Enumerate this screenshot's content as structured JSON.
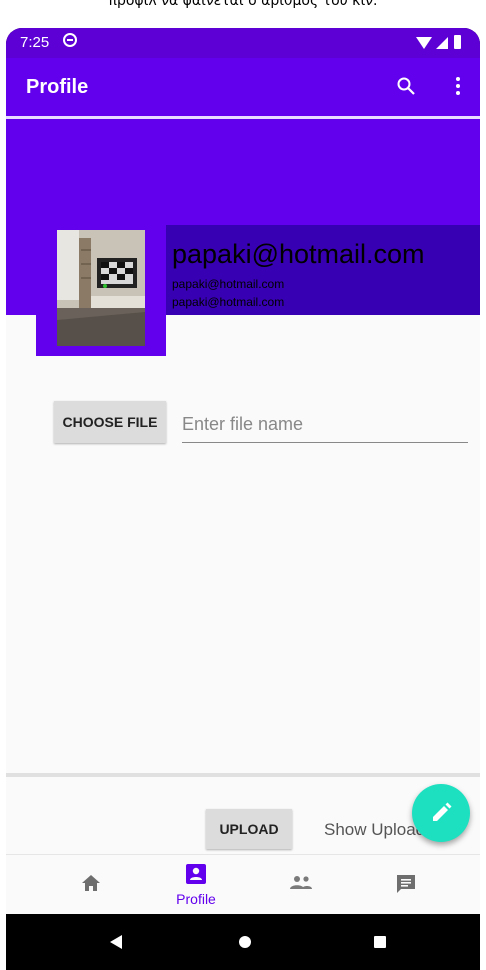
{
  "caption": "προφίλ να φαίνεται ο αριθμός του κιν.",
  "status": {
    "time": "7:25"
  },
  "appbar": {
    "title": "Profile"
  },
  "profile": {
    "email_main": "papaki@hotmail.com",
    "email_sub1": "papaki@hotmail.com",
    "email_sub2": "papaki@hotmail.com"
  },
  "file": {
    "choose_label": "CHOOSE FILE",
    "placeholder": "Enter file name",
    "value": ""
  },
  "upload": {
    "upload_label": "UPLOAD",
    "show_uploads_label": "Show Uploads"
  },
  "bottom_nav": {
    "items": [
      {
        "icon": "home-icon",
        "label": ""
      },
      {
        "icon": "profile-icon",
        "label": "Profile"
      },
      {
        "icon": "people-icon",
        "label": ""
      },
      {
        "icon": "chat-icon",
        "label": ""
      }
    ]
  },
  "colors": {
    "primary": "#6200ee",
    "primary_dark": "#3700b3",
    "accent": "#1de0c0"
  }
}
